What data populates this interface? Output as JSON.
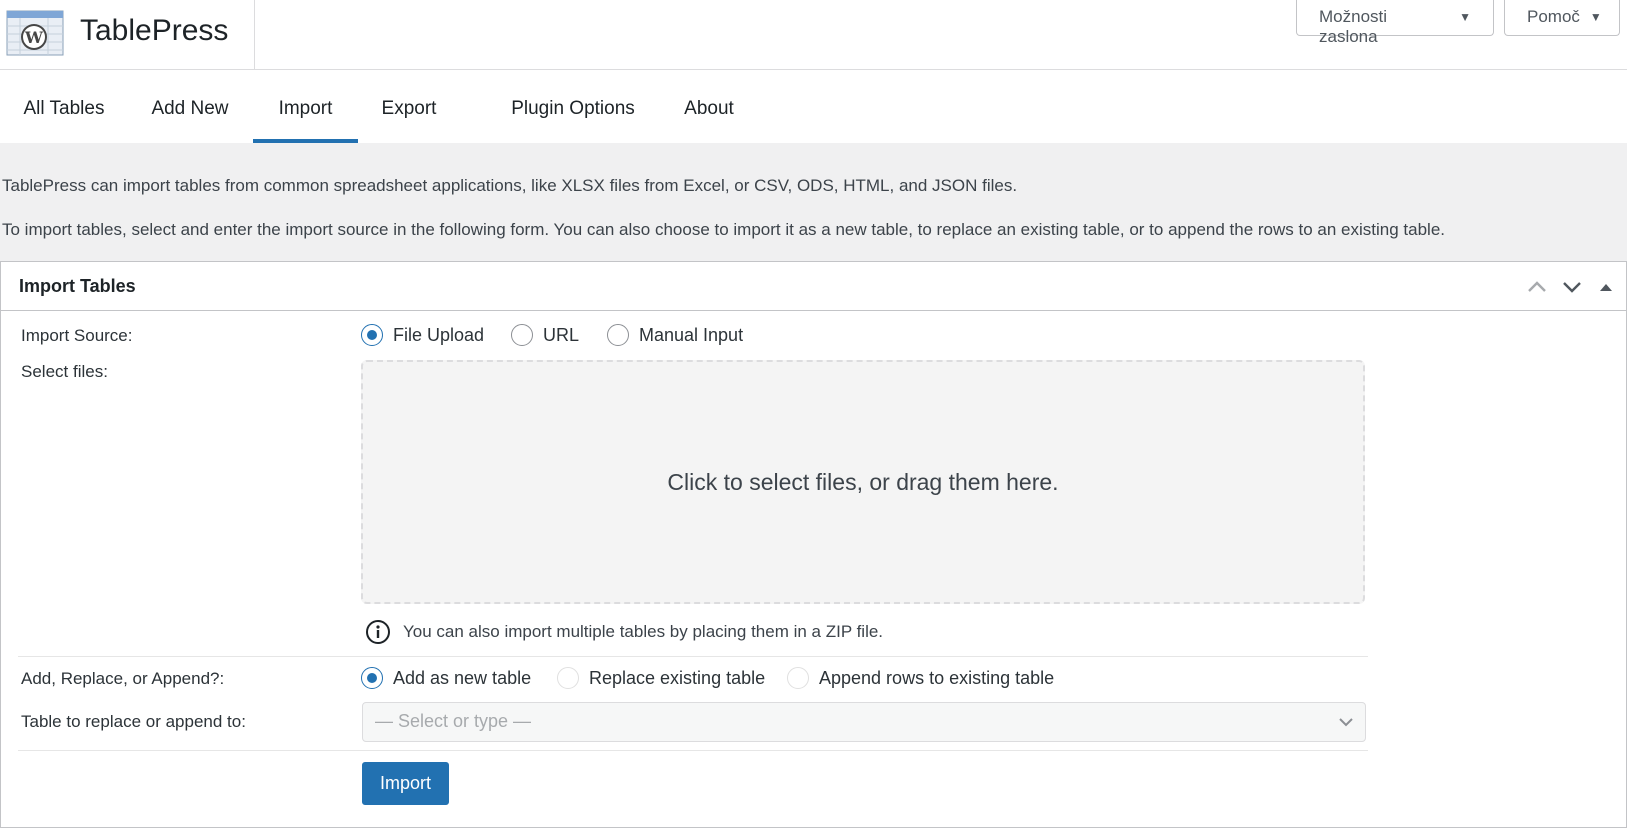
{
  "header": {
    "app_title": "TablePress",
    "screen_options_label": "Možnosti zaslona",
    "help_label": "Pomoč"
  },
  "nav": {
    "tabs": [
      {
        "label": "All Tables"
      },
      {
        "label": "Add New"
      },
      {
        "label": "Import",
        "active": true
      },
      {
        "label": "Export"
      },
      {
        "label": "Plugin Options"
      },
      {
        "label": "About"
      }
    ]
  },
  "intro": {
    "line1": "TablePress can import tables from common spreadsheet applications, like XLSX files from Excel, or CSV, ODS, HTML, and JSON files.",
    "line2": "To import tables, select and enter the import source in the following form. You can also choose to import it as a new table, to replace an existing table, or to append the rows to an existing table."
  },
  "panel": {
    "title": "Import Tables",
    "import_source": {
      "label": "Import Source:",
      "options": [
        {
          "label": "File Upload",
          "checked": true
        },
        {
          "label": "URL",
          "checked": false
        },
        {
          "label": "Manual Input",
          "checked": false
        }
      ]
    },
    "select_files": {
      "label": "Select files:",
      "dropzone_text": "Click to select files, or drag them here.",
      "hint": "You can also import multiple tables by placing them in a ZIP file."
    },
    "mode": {
      "label": "Add, Replace, or Append?:",
      "options": [
        {
          "label": "Add as new table",
          "checked": true
        },
        {
          "label": "Replace existing table",
          "checked": false
        },
        {
          "label": "Append rows to existing table",
          "checked": false
        }
      ]
    },
    "target_table": {
      "label": "Table to replace or append to:",
      "placeholder": "— Select or type —"
    },
    "import_button_label": "Import"
  },
  "colors": {
    "accent": "#2271b1",
    "background": "#f0f0f1"
  }
}
